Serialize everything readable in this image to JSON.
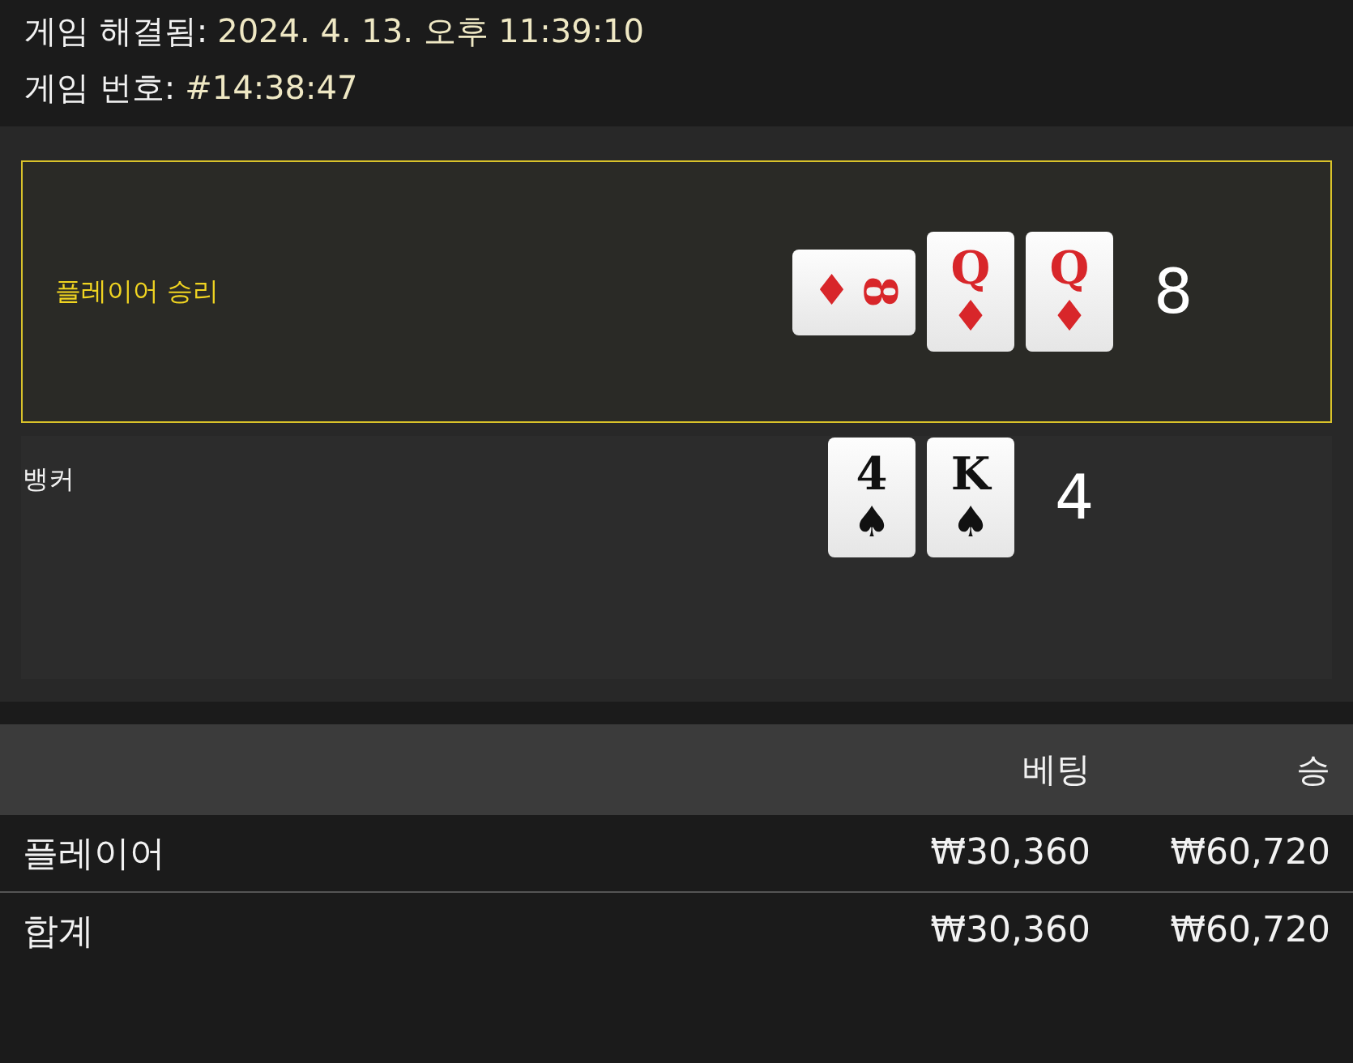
{
  "info": [
    {
      "label": "게임 해결됨:",
      "value": "2024. 4. 13. 오후 11:39:10"
    },
    {
      "label": "게임 번호:",
      "value": "#14:38:47"
    }
  ],
  "hands": [
    {
      "label": "플레이어 승리",
      "winner": true,
      "total": "8",
      "cards": [
        {
          "rank": "8",
          "suit": "♦",
          "sideways": true
        },
        {
          "rank": "Q",
          "suit": "♦",
          "sideways": false
        },
        {
          "rank": "Q",
          "suit": "♦",
          "sideways": false
        }
      ]
    },
    {
      "label": "뱅커",
      "winner": false,
      "total": "4",
      "cards": [
        {
          "rank": "4",
          "suit": "♠",
          "sideways": false
        },
        {
          "rank": "K",
          "suit": "♠",
          "sideways": false
        }
      ]
    }
  ],
  "table": {
    "columns": [
      "베팅",
      "승"
    ],
    "rows": [
      {
        "name": "플레이어",
        "bet": "₩30,360",
        "win": "₩60,720"
      },
      {
        "name": "합계",
        "bet": "₩30,360",
        "win": "₩60,720"
      }
    ]
  }
}
